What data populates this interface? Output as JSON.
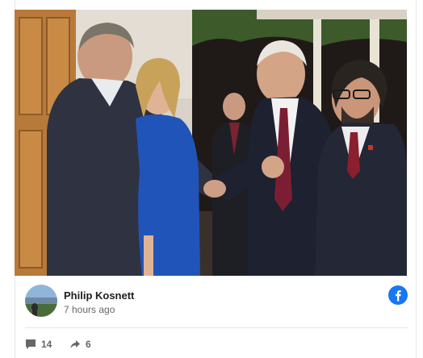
{
  "post": {
    "author": "Philip Kosnett",
    "timestamp": "7 hours ago",
    "comments_count": "14",
    "shares_count": "6",
    "network_icon": "facebook-icon",
    "brand_color": "#1877f2"
  }
}
